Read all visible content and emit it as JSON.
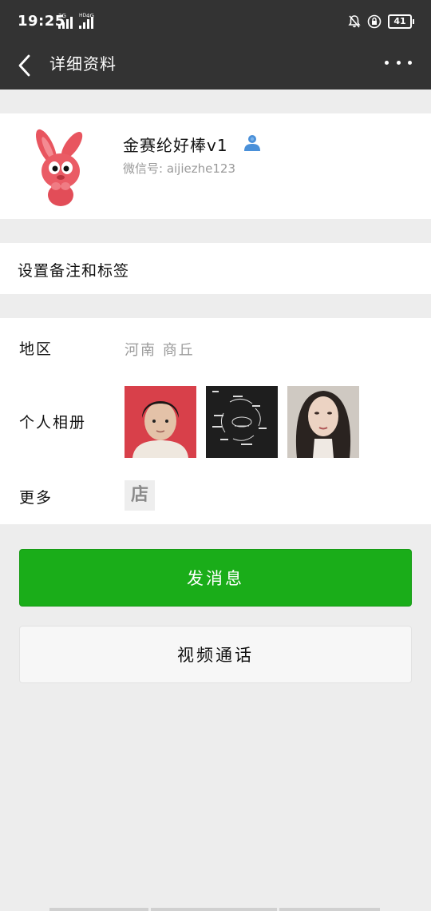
{
  "status_bar": {
    "time": "19:25",
    "sim1_tag": "3G",
    "sim2_tag": "4G",
    "sim2_tag_prefix": "HD",
    "battery": "41"
  },
  "header": {
    "title": "详细资料",
    "back_icon": "back-arrow-icon",
    "more_icon": "more-dots-icon"
  },
  "profile": {
    "nickname": "金赛纶好棒v1",
    "wechat_id": "微信号: aijiezhe123",
    "friend_icon": "person-icon",
    "friend_icon_color": "#4a90d9"
  },
  "remark": {
    "label": "设置备注和标签"
  },
  "info": {
    "region_label": "地区",
    "region_value": "河南  商丘",
    "album_label": "个人相册",
    "more_label": "更多",
    "shop_badge": "店"
  },
  "actions": {
    "send_message": "发消息",
    "video_call": "视频通话",
    "send_color": "#1aad19"
  },
  "colors": {
    "header_bg": "#333333",
    "page_bg": "#ededed"
  }
}
